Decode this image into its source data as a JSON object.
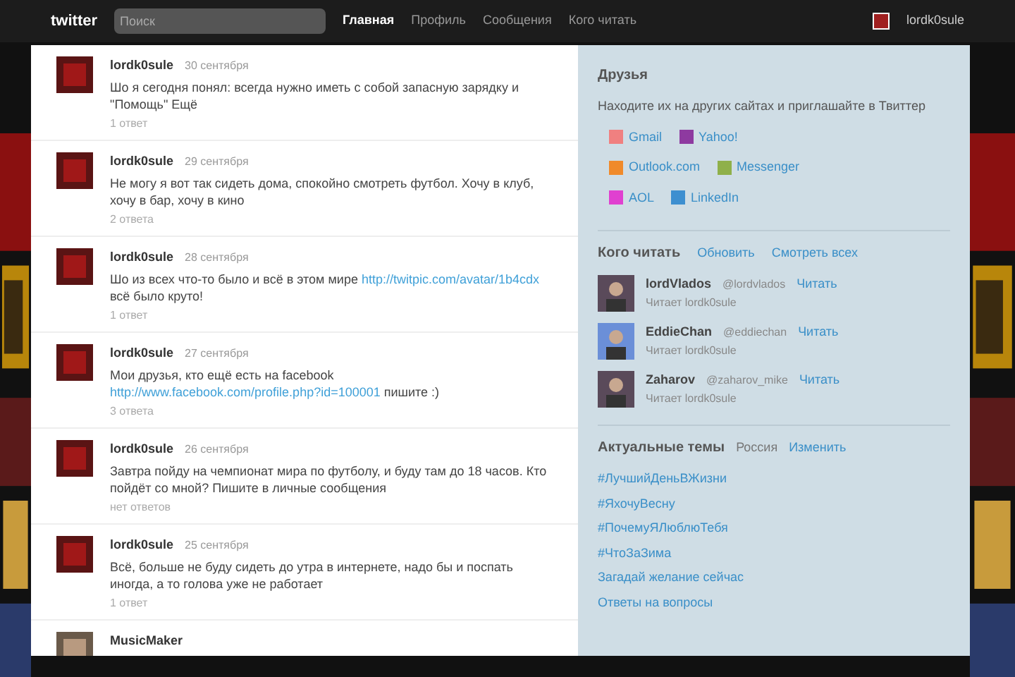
{
  "topbar": {
    "logo": "twitter",
    "search": {
      "placeholder": "Поиск"
    },
    "nav": [
      {
        "label": "Главная",
        "selected": true
      },
      {
        "label": "Профиль",
        "selected": false
      },
      {
        "label": "Сообщения",
        "selected": false
      },
      {
        "label": "Кого читать",
        "selected": false
      }
    ],
    "user": "lordk0sule"
  },
  "tweets": [
    {
      "name": "lordk0sule",
      "time": "30 сентября",
      "text": "Шо я сегодня понял: всегда нужно иметь с собой запасную зарядку и \"Помощь\" Ещё",
      "meta": "1 ответ"
    },
    {
      "name": "lordk0sule",
      "time": "29 сентября",
      "text": "Не могу я вот так сидеть дома, спокойно смотреть футбол. Хочу в клуб, хочу в бар, хочу в кино",
      "meta": "2 ответа"
    },
    {
      "name": "lordk0sule",
      "time": "28 сентября",
      "text": "Шо из всех что-то было и всё в этом мире ",
      "link": "http://twitpic.com/avatar/1b4cdx",
      "after": " всё было круто!",
      "meta": "1 ответ"
    },
    {
      "name": "lordk0sule",
      "time": "27 сентября",
      "text": "Мои друзья, кто ещё есть на facebook ",
      "link": "http://www.facebook.com/profile.php?id=100001",
      "after": " пишите :)",
      "meta": "3 ответа"
    },
    {
      "name": "lordk0sule",
      "time": "26 сентября",
      "text": "Завтра пойду на чемпионат мира по футболу, и буду там до 18 часов. Кто пойдёт со мной? Пишите в личные сообщения",
      "meta": "нет ответов"
    },
    {
      "name": "lordk0sule",
      "time": "25 сентября",
      "text": "Всё, больше не буду сидеть до утра в интернете, надо бы и поспать иногда, а то голова уже не работает",
      "meta": "1 ответ"
    },
    {
      "name": "MusicMaker"
    }
  ],
  "friends": {
    "title": "Друзья",
    "text": "Находите их на других сайтах и приглашайте в Твиттер",
    "links": [
      {
        "label": "Gmail",
        "color": "#f08080"
      },
      {
        "label": "Yahoo!",
        "color": "#8e3aa0"
      },
      {
        "label": "Outlook.com",
        "color": "#f08a2a"
      },
      {
        "label": "Messenger",
        "color": "#8fb04a"
      },
      {
        "label": "AOL",
        "color": "#e040d0"
      },
      {
        "label": "LinkedIn",
        "color": "#3d8fd0"
      }
    ]
  },
  "who_to_follow": {
    "title": "Кого читать",
    "actions": [
      "Обновить",
      "Смотреть всех"
    ],
    "people": [
      {
        "name": "lordVlados",
        "handle": "@lordvlados",
        "follow": "Читать",
        "sub": "Читает lordk0sule"
      },
      {
        "name": "EddieChan",
        "handle": "@eddiechan",
        "follow": "Читать",
        "sub": "Читает lordk0sule"
      },
      {
        "name": "Zaharov",
        "handle": "@zaharov_mike",
        "follow": "Читать",
        "sub": "Читает lordk0sule"
      }
    ]
  },
  "trends": {
    "title": "Актуальные темы",
    "region": "Россия",
    "change": "Изменить",
    "items": [
      "#ЛучшийДеньВЖизни",
      "#ЯхочуВеснy",
      "#ПочемуЯЛюблюТебя",
      "#ЧтоЗаЗима",
      "Загадай желание сейчас",
      "Ответы на вопросы"
    ]
  }
}
